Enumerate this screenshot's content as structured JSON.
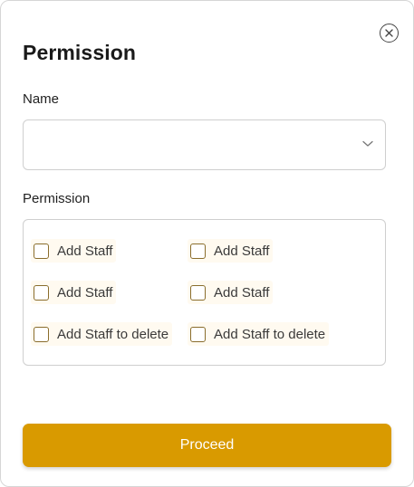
{
  "dialog": {
    "title": "Permission",
    "close_icon": "close-circle-icon"
  },
  "name_field": {
    "label": "Name",
    "value": "",
    "icon": "chevron-down-icon"
  },
  "permission_group": {
    "label": "Permission",
    "options": [
      {
        "label": "Add Staff",
        "checked": false
      },
      {
        "label": "Add Staff",
        "checked": false
      },
      {
        "label": "Add Staff",
        "checked": false
      },
      {
        "label": "Add Staff",
        "checked": false
      },
      {
        "label": "Add Staff to delete",
        "checked": false
      },
      {
        "label": "Add Staff to delete",
        "checked": false
      }
    ]
  },
  "proceed_button": {
    "label": "Proceed",
    "color": "#d99a00"
  }
}
